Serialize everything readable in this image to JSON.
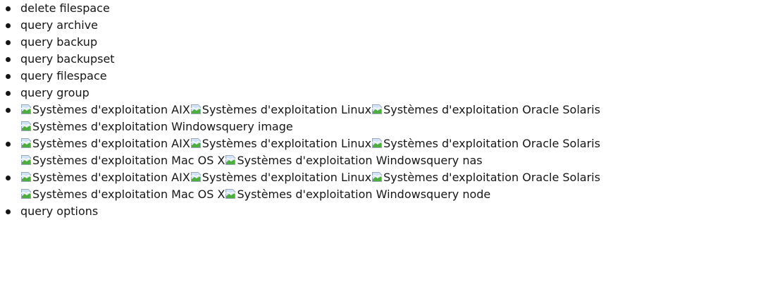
{
  "items": [
    {
      "text": "delete filespace"
    },
    {
      "text": "query archive"
    },
    {
      "text": "query backup"
    },
    {
      "text": "query backupset"
    },
    {
      "text": "query filespace"
    },
    {
      "text": "query group"
    },
    {
      "platforms": [
        {
          "icon": "broken-image-icon",
          "label": "Systèmes d'exploitation AIX"
        },
        {
          "icon": "broken-image-icon",
          "label": "Systèmes d'exploitation Linux"
        },
        {
          "icon": "broken-image-icon",
          "label": "Systèmes d'exploitation Oracle Solaris"
        },
        {
          "icon": "broken-image-icon",
          "label": "Systèmes d'exploitation Windows"
        }
      ],
      "text": "query image"
    },
    {
      "platforms": [
        {
          "icon": "broken-image-icon",
          "label": "Systèmes d'exploitation AIX"
        },
        {
          "icon": "broken-image-icon",
          "label": "Systèmes d'exploitation Linux"
        },
        {
          "icon": "broken-image-icon",
          "label": "Systèmes d'exploitation Oracle Solaris"
        },
        {
          "icon": "broken-image-icon",
          "label": "Systèmes d'exploitation Mac OS X"
        },
        {
          "icon": "broken-image-icon",
          "label": "Systèmes d'exploitation Windows"
        }
      ],
      "text": "query nas"
    },
    {
      "platforms": [
        {
          "icon": "broken-image-icon",
          "label": "Systèmes d'exploitation AIX"
        },
        {
          "icon": "broken-image-icon",
          "label": "Systèmes d'exploitation Linux"
        },
        {
          "icon": "broken-image-icon",
          "label": "Systèmes d'exploitation Oracle Solaris"
        },
        {
          "icon": "broken-image-icon",
          "label": "Systèmes d'exploitation Mac OS X"
        },
        {
          "icon": "broken-image-icon",
          "label": "Systèmes d'exploitation Windows"
        }
      ],
      "text": "query node"
    },
    {
      "text": "query options"
    }
  ]
}
